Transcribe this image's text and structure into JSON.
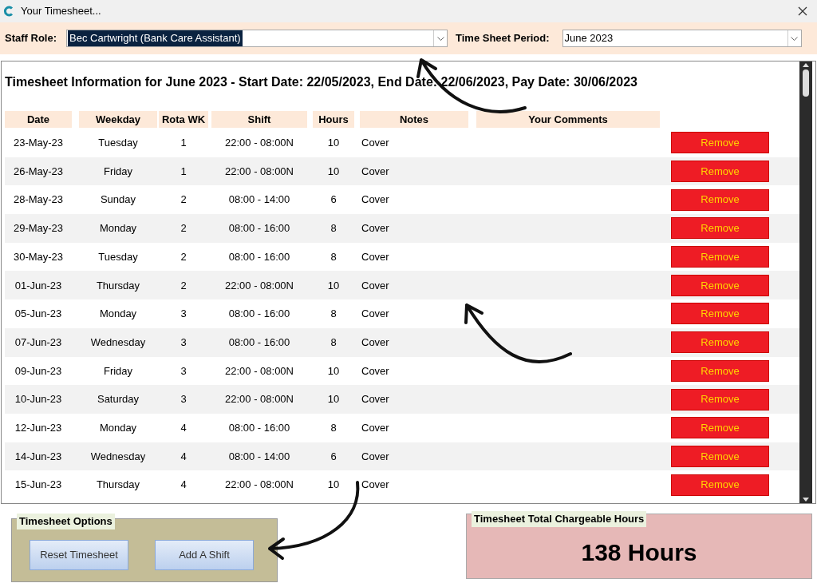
{
  "window": {
    "title": "Your Timesheet..."
  },
  "filters": {
    "staff_role_label": "Staff Role:",
    "staff_role_value": "Bec Cartwright (Bank Care Assistant)",
    "period_label": "Time Sheet Period:",
    "period_value": "June 2023"
  },
  "heading": "Timesheet Information for June 2023 - Start Date: 22/05/2023, End Date: 22/06/2023, Pay Date: 30/06/2023",
  "table": {
    "columns": [
      "Date",
      "Weekday",
      "Rota WK",
      "Shift",
      "Hours",
      "Notes",
      "Your Comments"
    ],
    "rows": [
      {
        "date": "23-May-23",
        "weekday": "Tuesday",
        "rota": "1",
        "shift": "22:00 - 08:00N",
        "hours": "10",
        "notes": "Cover",
        "action": "Remove"
      },
      {
        "date": "26-May-23",
        "weekday": "Friday",
        "rota": "1",
        "shift": "22:00 - 08:00N",
        "hours": "10",
        "notes": "Cover",
        "action": "Remove"
      },
      {
        "date": "28-May-23",
        "weekday": "Sunday",
        "rota": "2",
        "shift": "08:00 - 14:00",
        "hours": "6",
        "notes": "Cover",
        "action": "Remove"
      },
      {
        "date": "29-May-23",
        "weekday": "Monday",
        "rota": "2",
        "shift": "08:00 - 16:00",
        "hours": "8",
        "notes": "Cover",
        "action": "Remove"
      },
      {
        "date": "30-May-23",
        "weekday": "Tuesday",
        "rota": "2",
        "shift": "08:00 - 16:00",
        "hours": "8",
        "notes": "Cover",
        "action": "Remove"
      },
      {
        "date": "01-Jun-23",
        "weekday": "Thursday",
        "rota": "2",
        "shift": "22:00 - 08:00N",
        "hours": "10",
        "notes": "Cover",
        "action": "Remove"
      },
      {
        "date": "05-Jun-23",
        "weekday": "Monday",
        "rota": "3",
        "shift": "08:00 - 16:00",
        "hours": "8",
        "notes": "Cover",
        "action": "Remove"
      },
      {
        "date": "07-Jun-23",
        "weekday": "Wednesday",
        "rota": "3",
        "shift": "08:00 - 16:00",
        "hours": "8",
        "notes": "Cover",
        "action": "Remove"
      },
      {
        "date": "09-Jun-23",
        "weekday": "Friday",
        "rota": "3",
        "shift": "22:00 - 08:00N",
        "hours": "10",
        "notes": "Cover",
        "action": "Remove"
      },
      {
        "date": "10-Jun-23",
        "weekday": "Saturday",
        "rota": "3",
        "shift": "22:00 - 08:00N",
        "hours": "10",
        "notes": "Cover",
        "action": "Remove"
      },
      {
        "date": "12-Jun-23",
        "weekday": "Monday",
        "rota": "4",
        "shift": "08:00 - 16:00",
        "hours": "8",
        "notes": "Cover",
        "action": "Remove"
      },
      {
        "date": "14-Jun-23",
        "weekday": "Wednesday",
        "rota": "4",
        "shift": "08:00 - 14:00",
        "hours": "6",
        "notes": "Cover",
        "action": "Remove"
      },
      {
        "date": "15-Jun-23",
        "weekday": "Thursday",
        "rota": "4",
        "shift": "22:00 - 08:00N",
        "hours": "10",
        "notes": "Cover",
        "action": "Remove"
      }
    ]
  },
  "options": {
    "title": "Timesheet Options",
    "buttons": [
      "Reset Timesheet",
      "Add A Shift"
    ]
  },
  "total": {
    "title": "Timesheet Total Chargeable Hours",
    "value": "138 Hours"
  }
}
